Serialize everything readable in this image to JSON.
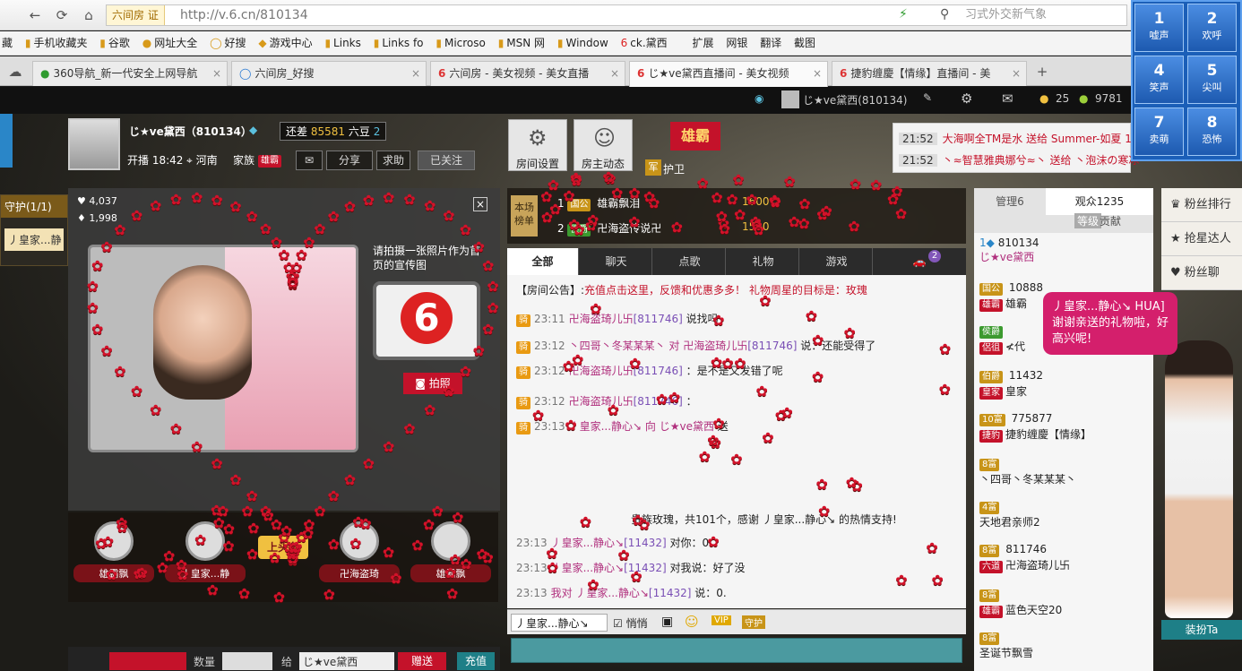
{
  "browser": {
    "site_chip": "六间房 证",
    "url": "http://v.6.cn/810134",
    "search_placeholder": "习式外交新气象",
    "bookmarks": [
      "手机收藏夹",
      "谷歌",
      "网址大全",
      "好搜",
      "游戏中心",
      "Links",
      "Links fo",
      "Microso",
      "MSN 网",
      "Window",
      "ck.黛西"
    ],
    "bookmark_lead": "藏",
    "tabs": [
      {
        "label": "360导航_新一代安全上网导航"
      },
      {
        "label": "六间房_好搜"
      },
      {
        "label": "六间房 - 美女视频 - 美女直播"
      },
      {
        "label": "じ★ve黛西直播间 - 美女视频"
      },
      {
        "label": "捷豹缠慶【情缘】直播间 - 美"
      }
    ],
    "tools": [
      "扩展",
      "网银",
      "翻译",
      "截图"
    ]
  },
  "site": {
    "user_name": "じ★ve黛西(810134)",
    "coins": "25",
    "beans": "9781"
  },
  "anchor": {
    "name": "じ★ve黛西（810134）",
    "gap_prefix": "还差",
    "gap_value": "85581",
    "gap_suffix": "六豆",
    "level": "2",
    "start_label": "开播",
    "start_time": "18:42",
    "location": "河南",
    "family_label": "家族",
    "family_tag": "雄霸",
    "share": "分享",
    "ask": "求助",
    "followed": "已关注"
  },
  "top_buttons": {
    "room_settings": "房间设置",
    "host_news": "房主动态",
    "family_badge": "雄霸",
    "guard_label": "军",
    "guard_text": "护卫"
  },
  "numpad": [
    {
      "num": "1",
      "label": "嘘声"
    },
    {
      "num": "2",
      "label": "欢呼"
    },
    {
      "num": "4",
      "label": "笑声"
    },
    {
      "num": "5",
      "label": "尖叫"
    },
    {
      "num": "7",
      "label": "卖萌"
    },
    {
      "num": "8",
      "label": "恐怖"
    }
  ],
  "gift_feed": [
    {
      "time": "21:52",
      "text": "大海啊全TM是水 送给 Summer-如夏 1个"
    },
    {
      "time": "21:52",
      "text": "丶≈智慧雅典娜兮≈丶 送给 丶泡沫の寒冰"
    }
  ],
  "guard_side": {
    "title": "守护(1/1)",
    "member": "丿皇家...静"
  },
  "video": {
    "stat_1": "4,037",
    "stat_2": "1,998",
    "promo_text": "请拍摄一张照片作为首页的宣传图",
    "snap": "拍照"
  },
  "rank_strip": {
    "members": [
      "雄霸飘",
      "丿皇家...静",
      "卍海盗琦",
      "雄霸飘"
    ],
    "center_sign": "上头条"
  },
  "chat_top": {
    "board": "本场榜单",
    "rows": [
      {
        "rank": "1",
        "tag": "国公",
        "name": "雄霸飘泪",
        "value": "1600"
      },
      {
        "rank": "2",
        "tag": "侯爵",
        "name": "卍海盗传说卍",
        "value": "1500"
      }
    ]
  },
  "chat_tabs": [
    "全部",
    "聊天",
    "点歌",
    "礼物",
    "游戏"
  ],
  "car_badge": "2",
  "notice": {
    "prefix": "【房间公告】:",
    "text": "充值点击这里，反馈和优惠多多！ 礼物周星的目标是：玫瑰"
  },
  "messages": [
    {
      "badge": "骑",
      "time": "23:11",
      "user": "卍海盗琦儿卐",
      "id": "[811746]",
      "text": "说找吗"
    },
    {
      "badge": "骑",
      "time": "23:12",
      "user": "丶四哥丶冬某某某丶 对 卍海盗琦儿卐",
      "id": "[811746]",
      "text": "说：还能受得了"
    },
    {
      "badge": "骑",
      "time": "23:12",
      "user": "卍海盗琦儿卐",
      "id": "[811746]",
      "text": "：是不是又发错了呢"
    },
    {
      "badge": "骑",
      "time": "23:12",
      "user": "卍海盗琦儿卐",
      "id": "[811746]",
      "text": "："
    },
    {
      "badge": "骑",
      "time": "23:13",
      "user": "丿皇家...静心↘ 向 じ★ve黛西",
      "id": "",
      "text": "送"
    },
    {
      "badge": "",
      "time": "23:13",
      "user": "丿皇家...静心↘",
      "id": "[11432]",
      "text": "对你：0"
    },
    {
      "badge": "",
      "time": "23:13",
      "user": "丿皇家...静心↘",
      "id": "[11432]",
      "text": "对我说：好了没"
    },
    {
      "badge": "",
      "time": "23:13",
      "user": "我对 丿皇家...静心↘",
      "id": "[11432]",
      "text": "说：0."
    }
  ],
  "thanks": "贵族玫瑰，共101个，感谢 丿皇家...静心↘ 的热情支持!",
  "chat_tools": {
    "target": "丿皇家...静心↘",
    "private": "悄悄",
    "vip": "VIP",
    "guard": "守护"
  },
  "members": {
    "tab_admin": "管理6",
    "tab_audience": "观众1235",
    "sort_level": "等级",
    "sort_contrib": "贡献",
    "rows": [
      {
        "tag": "",
        "id": "810134",
        "name": "じ★ve黛西"
      },
      {
        "tag": "国公",
        "id": "10888",
        "name": "雄霸"
      },
      {
        "tag": "侯爵",
        "id": "",
        "name": "≮代"
      },
      {
        "tag": "伯爵",
        "id": "11432",
        "name": "皇家"
      },
      {
        "tag": "10富",
        "id": "775877",
        "name": "捷豹缠慶【情缘】"
      },
      {
        "tag": "8富",
        "id": "",
        "name": "丶四哥丶冬某某某丶"
      },
      {
        "tag": "4富",
        "id": "",
        "name": "天地君亲师2"
      },
      {
        "tag": "8富",
        "id": "811746",
        "name": "卍海盗琦儿卐"
      },
      {
        "tag": "8富",
        "id": "",
        "name": "蓝色天空20"
      },
      {
        "tag": "8富",
        "id": "",
        "name": "圣诞节飘雪"
      }
    ],
    "row_tags": [
      "",
      "雄霸",
      "侶徂",
      "皇家",
      "捷豹",
      "",
      "",
      "六道",
      "雄霸",
      ""
    ]
  },
  "right_panel": [
    "粉丝排行",
    "抢星达人",
    "粉丝聊"
  ],
  "bubble": "丿皇家...静心↘ HUA]谢谢亲送的礼物啦，好高兴呢!",
  "dress_up": "装扮Ta",
  "gift_bar": {
    "qty_label": "数量",
    "to_label": "给",
    "to_value": "じ★ve黛西",
    "send": "赠送",
    "recharge": "充值"
  }
}
